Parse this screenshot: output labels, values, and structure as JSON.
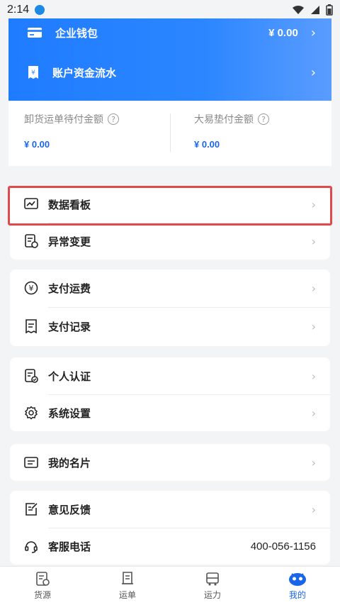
{
  "status_bar": {
    "time": "2:14"
  },
  "wallet": {
    "enterprise_wallet": {
      "label": "企业钱包",
      "value": "¥ 0.00"
    },
    "account_flow": {
      "label": "账户资金流水"
    }
  },
  "amounts": {
    "unload_pending": {
      "label": "卸货运单待付金额",
      "value": "¥ 0.00"
    },
    "dayi_advance": {
      "label": "大易垫付金额",
      "value": "¥ 0.00"
    }
  },
  "menu": {
    "data_board": "数据看板",
    "exception_change": "异常变更",
    "pay_freight": "支付运费",
    "pay_records": "支付记录",
    "personal_auth": "个人认证",
    "system_settings": "系统设置",
    "my_card": "我的名片",
    "feedback": "意见反馈",
    "customer_service": "客服电话",
    "customer_service_phone": "400-056-1156"
  },
  "tabbar": {
    "goods": "货源",
    "waybill": "运单",
    "capacity": "运力",
    "mine": "我的"
  },
  "colors": {
    "accent": "#1a66e8",
    "highlight": "#e14a4a"
  }
}
